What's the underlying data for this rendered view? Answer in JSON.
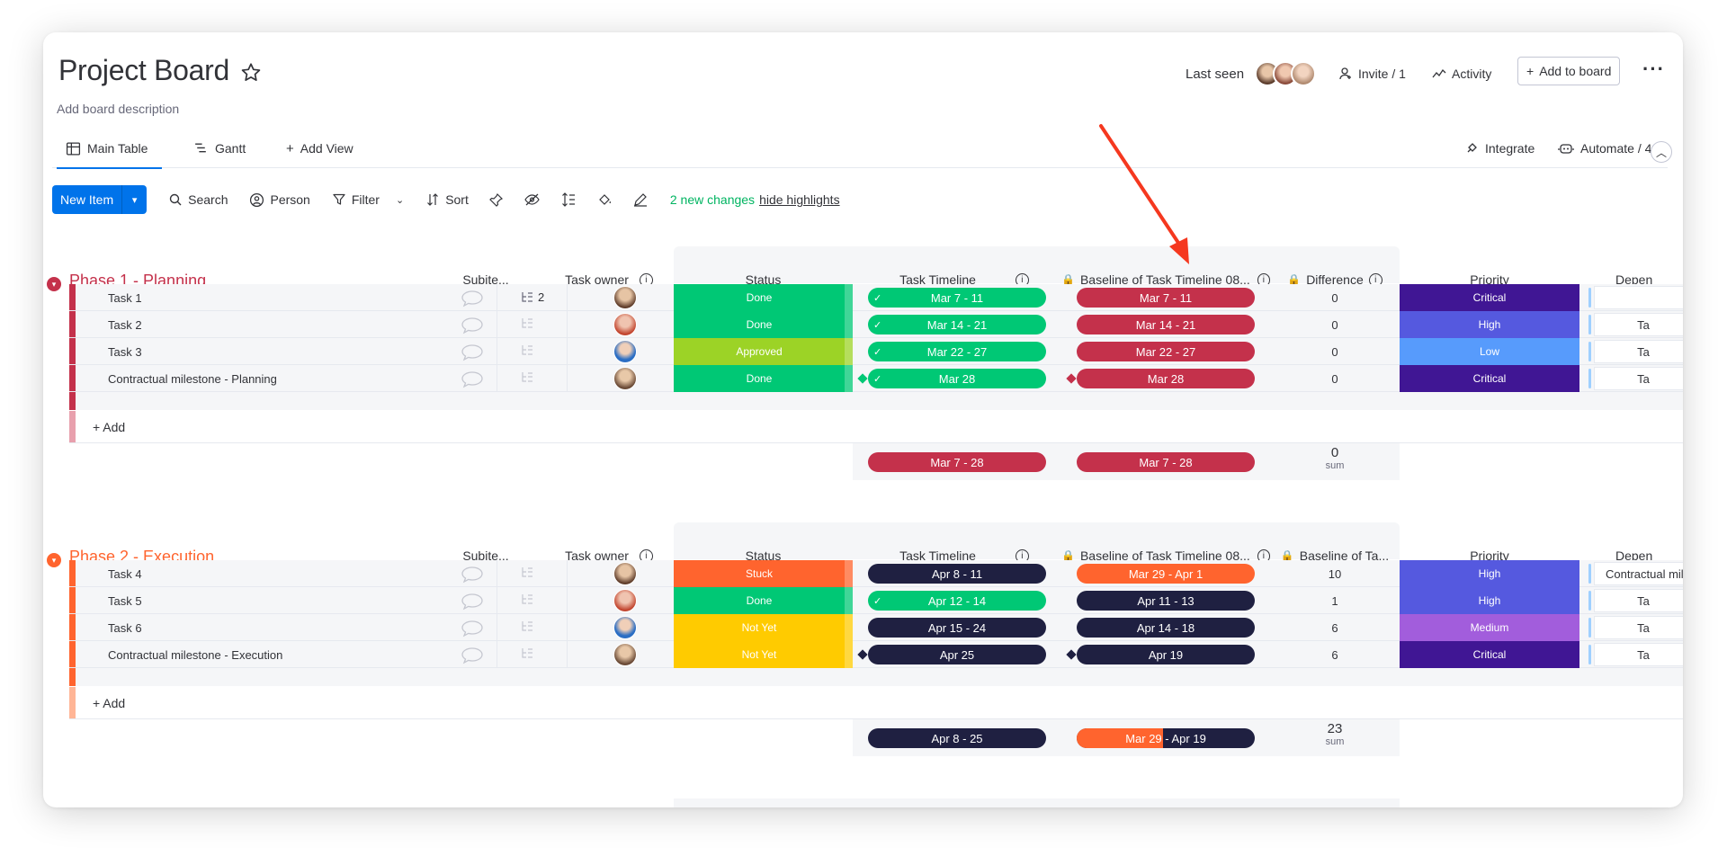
{
  "board": {
    "title": "Project Board",
    "description": "Add board description",
    "last_seen": "Last seen",
    "invite": "Invite / 1",
    "activity": "Activity",
    "add_to_board": "Add to board"
  },
  "views": {
    "main_table": "Main Table",
    "gantt": "Gantt",
    "add_view": "Add View",
    "integrate": "Integrate",
    "automate": "Automate / 4"
  },
  "toolbar": {
    "new_item": "New Item",
    "search": "Search",
    "person": "Person",
    "filter": "Filter",
    "sort": "Sort",
    "changes": "2 new changes",
    "hide_highlights": "hide highlights"
  },
  "columns": {
    "subitems": "Subite...",
    "owner": "Task owner",
    "status": "Status",
    "timeline": "Task Timeline",
    "baseline": "Baseline of Task Timeline 08...",
    "difference": "Difference",
    "baseline_short": "Baseline of Ta...",
    "priority": "Priority",
    "dependency": "Depen"
  },
  "add_label": "+ Add",
  "sum_label": "sum",
  "group1": {
    "title": "Phase 1 - Planning",
    "color": "#c4314b",
    "rows": [
      {
        "name": "Task 1",
        "subitems": "2",
        "status": "Done",
        "status_color": "#00c875",
        "timeline": "Mar 7 - 11",
        "baseline": "Mar 7 - 11",
        "diff": "0",
        "priority": "Critical",
        "prio_color": "#401694",
        "dep": ""
      },
      {
        "name": "Task 2",
        "subitems": "",
        "status": "Done",
        "status_color": "#00c875",
        "timeline": "Mar 14 - 21",
        "baseline": "Mar 14 - 21",
        "diff": "0",
        "priority": "High",
        "prio_color": "#5559df",
        "dep": "Ta"
      },
      {
        "name": "Task 3",
        "subitems": "",
        "status": "Approved",
        "status_color": "#9cd326",
        "timeline": "Mar 22 - 27",
        "baseline": "Mar 22 - 27",
        "diff": "0",
        "priority": "Low",
        "prio_color": "#579bfc",
        "dep": "Ta"
      },
      {
        "name": "Contractual milestone - Planning",
        "subitems": "",
        "status": "Done",
        "status_color": "#00c875",
        "timeline": "Mar 28",
        "baseline": "Mar 28",
        "diff": "0",
        "priority": "Critical",
        "prio_color": "#401694",
        "dep": "Ta"
      }
    ],
    "sum_timeline": "Mar 7 - 28",
    "sum_baseline": "Mar 7 - 28",
    "sum_value": "0"
  },
  "group2": {
    "title": "Phase 2 - Execution",
    "color": "#ff642e",
    "rows": [
      {
        "name": "Task 4",
        "status": "Stuck",
        "status_color": "#ff642e",
        "timeline": "Apr 8 - 11",
        "baseline": "Mar 29 - Apr 1",
        "diff": "10",
        "priority": "High",
        "prio_color": "#5559df",
        "dep": "Contractual mil"
      },
      {
        "name": "Task 5",
        "status": "Done",
        "status_color": "#00c875",
        "timeline": "Apr 12 - 14",
        "baseline": "Apr 11 - 13",
        "diff": "1",
        "priority": "High",
        "prio_color": "#5559df",
        "dep": "Ta"
      },
      {
        "name": "Task 6",
        "status": "Not Yet",
        "status_color": "#ffcb00",
        "timeline": "Apr 15 - 24",
        "baseline": "Apr 14 - 18",
        "diff": "6",
        "priority": "Medium",
        "prio_color": "#a25ddc",
        "dep": "Ta"
      },
      {
        "name": "Contractual milestone - Execution",
        "status": "Not Yet",
        "status_color": "#ffcb00",
        "timeline": "Apr 25",
        "baseline": "Apr 19",
        "diff": "6",
        "priority": "Critical",
        "prio_color": "#401694",
        "dep": "Ta"
      }
    ],
    "sum_timeline": "Apr 8 - 25",
    "sum_baseline_a": "Mar 29",
    "sum_baseline_b": " - Apr 19",
    "sum_value": "23"
  },
  "colors": {
    "primary": "#0073ea",
    "done": "#00c875",
    "navy": "#1f2041",
    "baseline_red": "#c4314b",
    "arrow": "#f5381f"
  }
}
